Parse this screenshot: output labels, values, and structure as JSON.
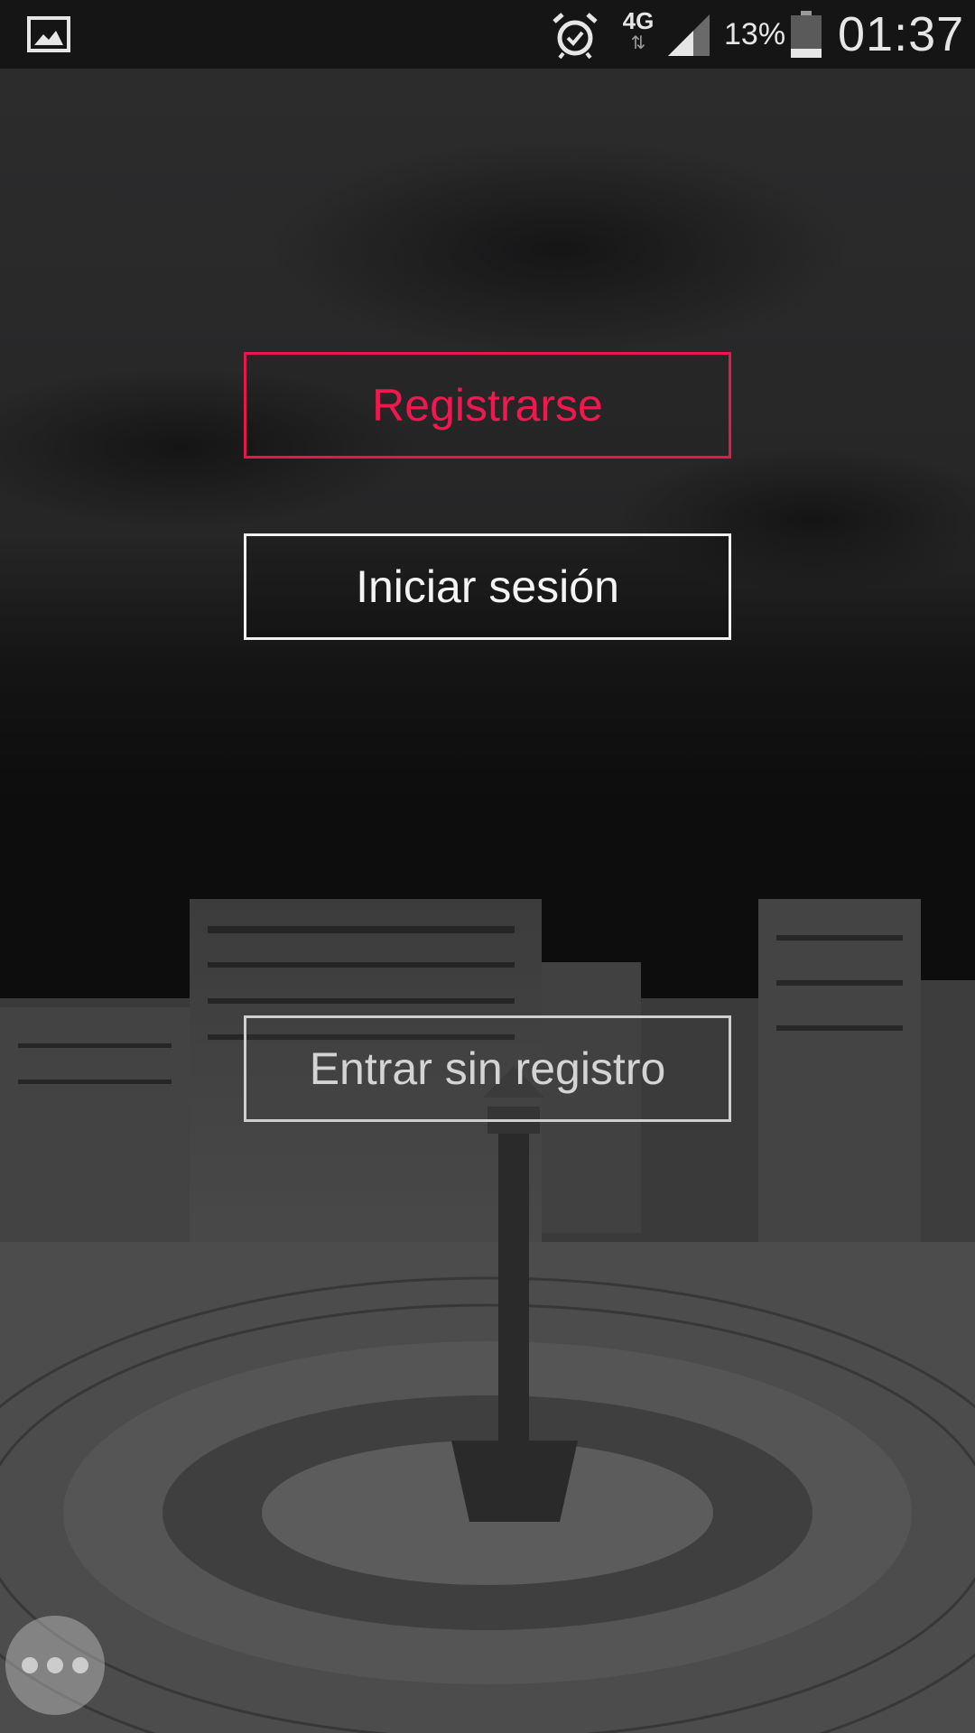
{
  "status_bar": {
    "network_type": "4G",
    "network_arrows": "⇅",
    "battery_percent": "13%",
    "time": "01:37",
    "icons": [
      "gallery-icon",
      "alarm-icon",
      "signal-icon",
      "battery-icon"
    ]
  },
  "buttons": {
    "register": "Registrarse",
    "login": "Iniciar sesión",
    "guest": "Entrar sin registro"
  },
  "colors": {
    "accent": "#e8174b",
    "background": "#0c0c0d",
    "text_light": "#f4f4f4"
  }
}
